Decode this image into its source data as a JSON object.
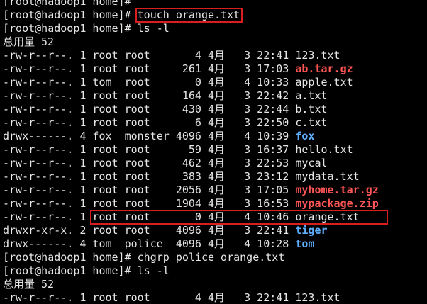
{
  "colors": {
    "background": "#000000",
    "text": "#e6e6e6",
    "archive": "#ff5555",
    "directory": "#5fafff",
    "highlight_box": "#d81e1e"
  },
  "lines": [
    {
      "segs": [
        {
          "t": "[root@hadoop1 home]# "
        }
      ]
    },
    {
      "segs": [
        {
          "t": "[root@hadoop1 home]# "
        },
        {
          "t": "touch orange.txt"
        }
      ]
    },
    {
      "segs": [
        {
          "t": "[root@hadoop1 home]# ls -l"
        }
      ]
    },
    {
      "segs": [
        {
          "t": "总用量 52"
        }
      ]
    },
    {
      "segs": [
        {
          "t": "-rw-r--r--. 1 root root       4 4月   3 22:41 "
        },
        {
          "t": "123.txt"
        }
      ]
    },
    {
      "segs": [
        {
          "t": "-rw-r--r--. 1 root root     261 4月   3 17:03 "
        },
        {
          "t": "ab.tar.gz",
          "c": "red"
        }
      ]
    },
    {
      "segs": [
        {
          "t": "-rw-r--r--. 1 tom  root       0 4月   4 10:33 "
        },
        {
          "t": "apple.txt"
        }
      ]
    },
    {
      "segs": [
        {
          "t": "-rw-r--r--. 1 root root     164 4月   3 22:42 "
        },
        {
          "t": "a.txt"
        }
      ]
    },
    {
      "segs": [
        {
          "t": "-rw-r--r--. 1 root root     430 4月   3 22:44 "
        },
        {
          "t": "b.txt"
        }
      ]
    },
    {
      "segs": [
        {
          "t": "-rw-r--r--. 1 root root       6 4月   3 22:50 "
        },
        {
          "t": "c.txt"
        }
      ]
    },
    {
      "segs": [
        {
          "t": "drwx------. 4 fox  monster 4096 4月   4 10:39 "
        },
        {
          "t": "fox",
          "c": "blue"
        }
      ]
    },
    {
      "segs": [
        {
          "t": "-rw-r--r--. 1 root root      59 4月   3 16:37 "
        },
        {
          "t": "hello.txt"
        }
      ]
    },
    {
      "segs": [
        {
          "t": "-rw-r--r--. 1 root root     462 4月   3 22:53 "
        },
        {
          "t": "mycal"
        }
      ]
    },
    {
      "segs": [
        {
          "t": "-rw-r--r--. 1 root root     383 4月   3 23:12 "
        },
        {
          "t": "mydata.txt"
        }
      ]
    },
    {
      "segs": [
        {
          "t": "-rw-r--r--. 1 root root    2056 4月   3 17:05 "
        },
        {
          "t": "myhome.tar.gz",
          "c": "red"
        }
      ]
    },
    {
      "segs": [
        {
          "t": "-rw-r--r--. 1 root root    1904 4月   3 16:53 "
        },
        {
          "t": "mypackage.zip",
          "c": "red"
        }
      ]
    },
    {
      "segs": [
        {
          "t": "-rw-r--r--. 1 "
        },
        {
          "t": "root root       0 4月   4 10:46 orange.txt"
        }
      ]
    },
    {
      "segs": [
        {
          "t": "drwxr-xr-x. 2 root root    4096 4月   3 22:41 "
        },
        {
          "t": "tiger",
          "c": "blue"
        }
      ]
    },
    {
      "segs": [
        {
          "t": "drwx------. 4 tom  police  4096 4月   4 10:28 "
        },
        {
          "t": "tom",
          "c": "blue"
        }
      ]
    },
    {
      "segs": [
        {
          "t": "[root@hadoop1 home]# chgrp police orange.txt"
        }
      ]
    },
    {
      "segs": [
        {
          "t": "[root@hadoop1 home]# ls -l"
        }
      ]
    },
    {
      "segs": [
        {
          "t": "总用量 52"
        }
      ]
    },
    {
      "segs": [
        {
          "t": "-rw-r--r--. 1 root root       4 4月   3 22:41 "
        },
        {
          "t": "123.txt"
        }
      ]
    }
  ]
}
